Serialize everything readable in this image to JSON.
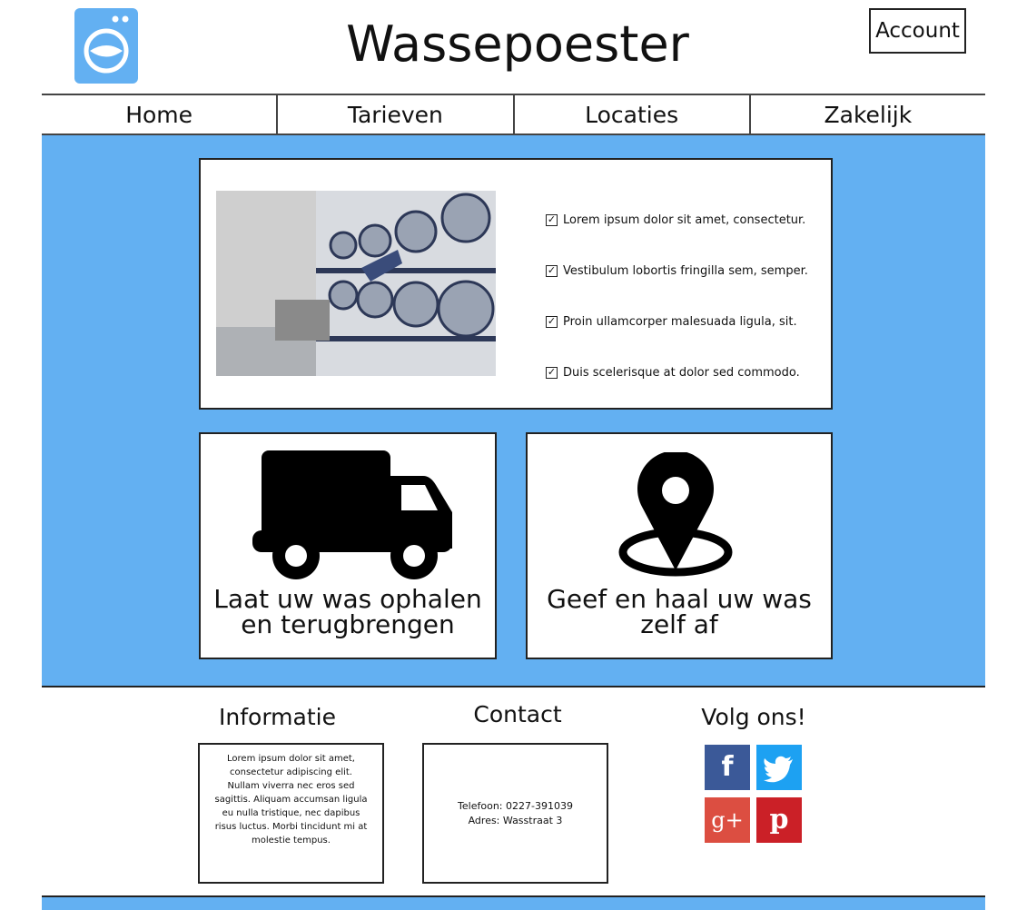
{
  "header": {
    "title": "Wassepoester",
    "account_label": "Account",
    "logo_icon": "washing-machine-icon"
  },
  "nav": {
    "items": [
      "Home",
      "Tarieven",
      "Locaties",
      "Zakelijk"
    ]
  },
  "hero": {
    "background_color": "#63b0f2",
    "checklist": [
      "Lorem ipsum dolor sit amet, consectetur.",
      "Vestibulum lobortis fringilla sem, semper.",
      "Proin ullamcorper malesuada ligula, sit.",
      "Duis scelerisque at dolor sed commodo."
    ],
    "cards": [
      {
        "icon": "truck-icon",
        "caption_line1": "Laat uw was ophalen",
        "caption_line2": "en terugbrengen"
      },
      {
        "icon": "map-pin-icon",
        "caption_line1": "Geef en haal uw was",
        "caption_line2": "zelf af"
      }
    ]
  },
  "footer": {
    "info_title": "Informatie",
    "info_text": "Lorem ipsum dolor sit amet, consectetur adipiscing elit. Nullam viverra nec eros sed sagittis. Aliquam accumsan ligula eu nulla tristique, nec dapibus risus luctus. Morbi tincidunt mi at molestie tempus.",
    "contact_title": "Contact",
    "contact_phone": "Telefoon: 0227-391039",
    "contact_address": "Adres: Wasstraat 3",
    "social_title": "Volg ons!",
    "social": [
      {
        "icon": "facebook-icon",
        "glyph": "f",
        "color": "#3b5998"
      },
      {
        "icon": "twitter-icon",
        "glyph": "",
        "color": "#1da1f2"
      },
      {
        "icon": "google-plus-icon",
        "glyph": "g+",
        "color": "#dc4e41"
      },
      {
        "icon": "pinterest-icon",
        "glyph": "p",
        "color": "#cb2027"
      }
    ]
  }
}
